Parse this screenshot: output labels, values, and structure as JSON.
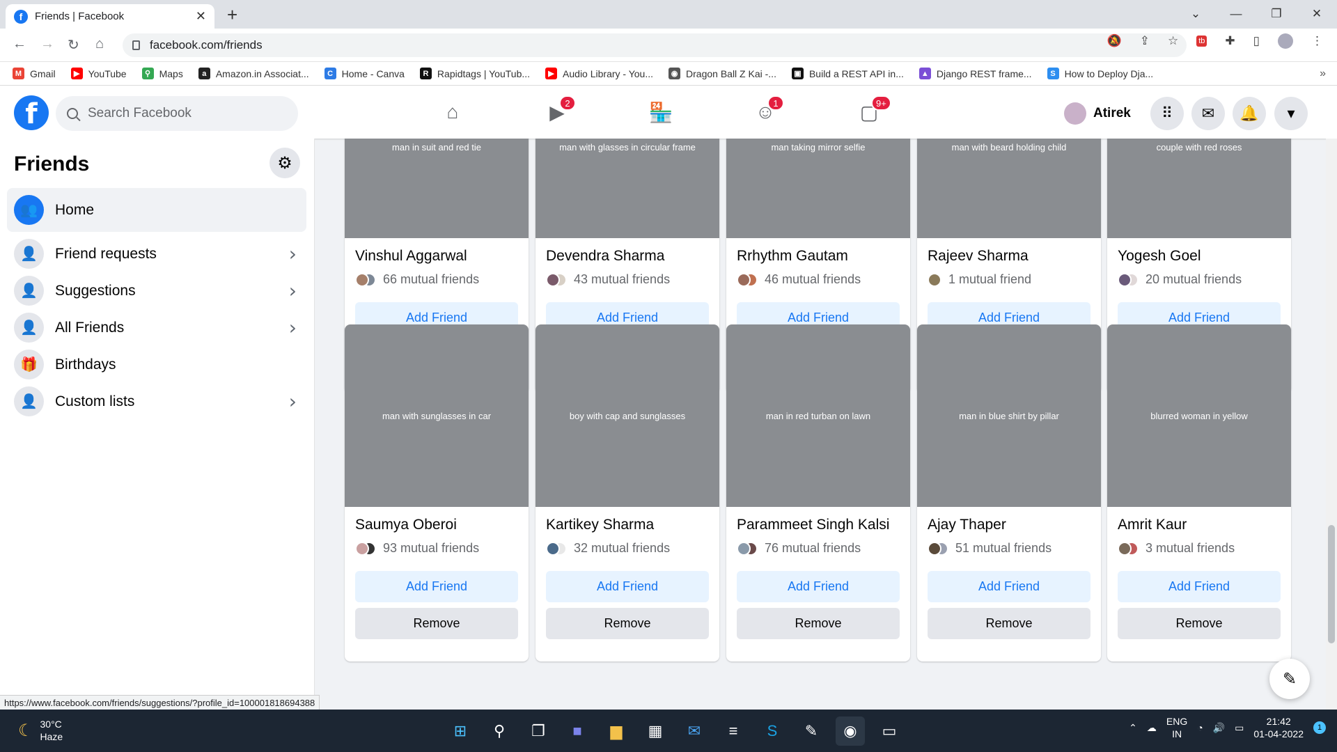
{
  "browser": {
    "tab_title": "Friends | Facebook",
    "url": "facebook.com/friends",
    "bookmarks": [
      {
        "label": "Gmail",
        "color": "#ea4335",
        "glyph": "M"
      },
      {
        "label": "YouTube",
        "color": "#ff0000",
        "glyph": "▶"
      },
      {
        "label": "Maps",
        "color": "#34a853",
        "glyph": "⚲"
      },
      {
        "label": "Amazon.in Associat...",
        "color": "#222222",
        "glyph": "a"
      },
      {
        "label": "Home - Canva",
        "color": "#2d7be5",
        "glyph": "C"
      },
      {
        "label": "Rapidtags | YouTub...",
        "color": "#111111",
        "glyph": "R"
      },
      {
        "label": "Audio Library - You...",
        "color": "#ff0000",
        "glyph": "▶"
      },
      {
        "label": "Dragon Ball Z Kai -...",
        "color": "#555555",
        "glyph": "◉"
      },
      {
        "label": "Build a REST API in...",
        "color": "#111111",
        "glyph": "▣"
      },
      {
        "label": "Django REST frame...",
        "color": "#7b4fd6",
        "glyph": "▲"
      },
      {
        "label": "How to Deploy Dja...",
        "color": "#2d8ef0",
        "glyph": "S"
      }
    ]
  },
  "fb": {
    "search_placeholder": "Search Facebook",
    "user_name": "Atirek",
    "badges": {
      "watch": "2",
      "groups": "1",
      "gaming": "9+"
    }
  },
  "sidebar": {
    "title": "Friends",
    "items": [
      {
        "label": "Home",
        "glyph": "👥",
        "chevron": false,
        "active": true
      },
      {
        "label": "Friend requests",
        "glyph": "👤",
        "chevron": true,
        "active": false
      },
      {
        "label": "Suggestions",
        "glyph": "👤",
        "chevron": true,
        "active": false
      },
      {
        "label": "All Friends",
        "glyph": "👤",
        "chevron": true,
        "active": false
      },
      {
        "label": "Birthdays",
        "glyph": "🎁",
        "chevron": false,
        "active": false
      },
      {
        "label": "Custom lists",
        "glyph": "👤",
        "chevron": true,
        "active": false
      }
    ]
  },
  "buttons": {
    "add": "Add Friend",
    "remove": "Remove"
  },
  "cards": [
    {
      "name": "Vinshul Aggarwal",
      "mutual": "66 mutual friends",
      "photo": "man in suit and red tie",
      "c1": "#a57f6a",
      "c2": "#7d8896"
    },
    {
      "name": "Devendra Sharma",
      "mutual": "43 mutual friends",
      "photo": "man with glasses in circular frame",
      "c1": "#7a5a6a",
      "c2": "#d8d0c6"
    },
    {
      "name": "Rrhythm Gautam",
      "mutual": "46 mutual friends",
      "photo": "man taking mirror selfie",
      "c1": "#9a6a5a",
      "c2": "#c07050"
    },
    {
      "name": "Rajeev Sharma",
      "mutual": "1 mutual friend",
      "photo": "man with beard holding child",
      "c1": "#8a7a5a",
      "c2": ""
    },
    {
      "name": "Yogesh Goel",
      "mutual": "20 mutual friends",
      "photo": "couple with red roses",
      "c1": "#6a5a7a",
      "c2": "#e0d8d8"
    },
    {
      "name": "Saumya Oberoi",
      "mutual": "93 mutual friends",
      "photo": "man with sunglasses in car",
      "c1": "#c9a0a0",
      "c2": "#333333"
    },
    {
      "name": "Kartikey Sharma",
      "mutual": "32 mutual friends",
      "photo": "boy with cap and sunglasses",
      "c1": "#4a6a8a",
      "c2": "#e8e8e8"
    },
    {
      "name": "Parammeet Singh Kalsi",
      "mutual": "76 mutual friends",
      "photo": "man in red turban on lawn",
      "c1": "#8a9aaa",
      "c2": "#6a4a4a"
    },
    {
      "name": "Ajay Thaper",
      "mutual": "51 mutual friends",
      "photo": "man in blue shirt by pillar",
      "c1": "#5a4a3a",
      "c2": "#9aa0b0"
    },
    {
      "name": "Amrit Kaur",
      "mutual": "3 mutual friends",
      "photo": "blurred woman in yellow",
      "c1": "#7a6a5a",
      "c2": "#c05a5a"
    }
  ],
  "status_url": "https://www.facebook.com/friends/suggestions/?profile_id=100001818694388",
  "taskbar": {
    "temp": "30°C",
    "weather": "Haze",
    "lang1": "ENG",
    "lang2": "IN",
    "time": "21:42",
    "date": "01-04-2022"
  }
}
